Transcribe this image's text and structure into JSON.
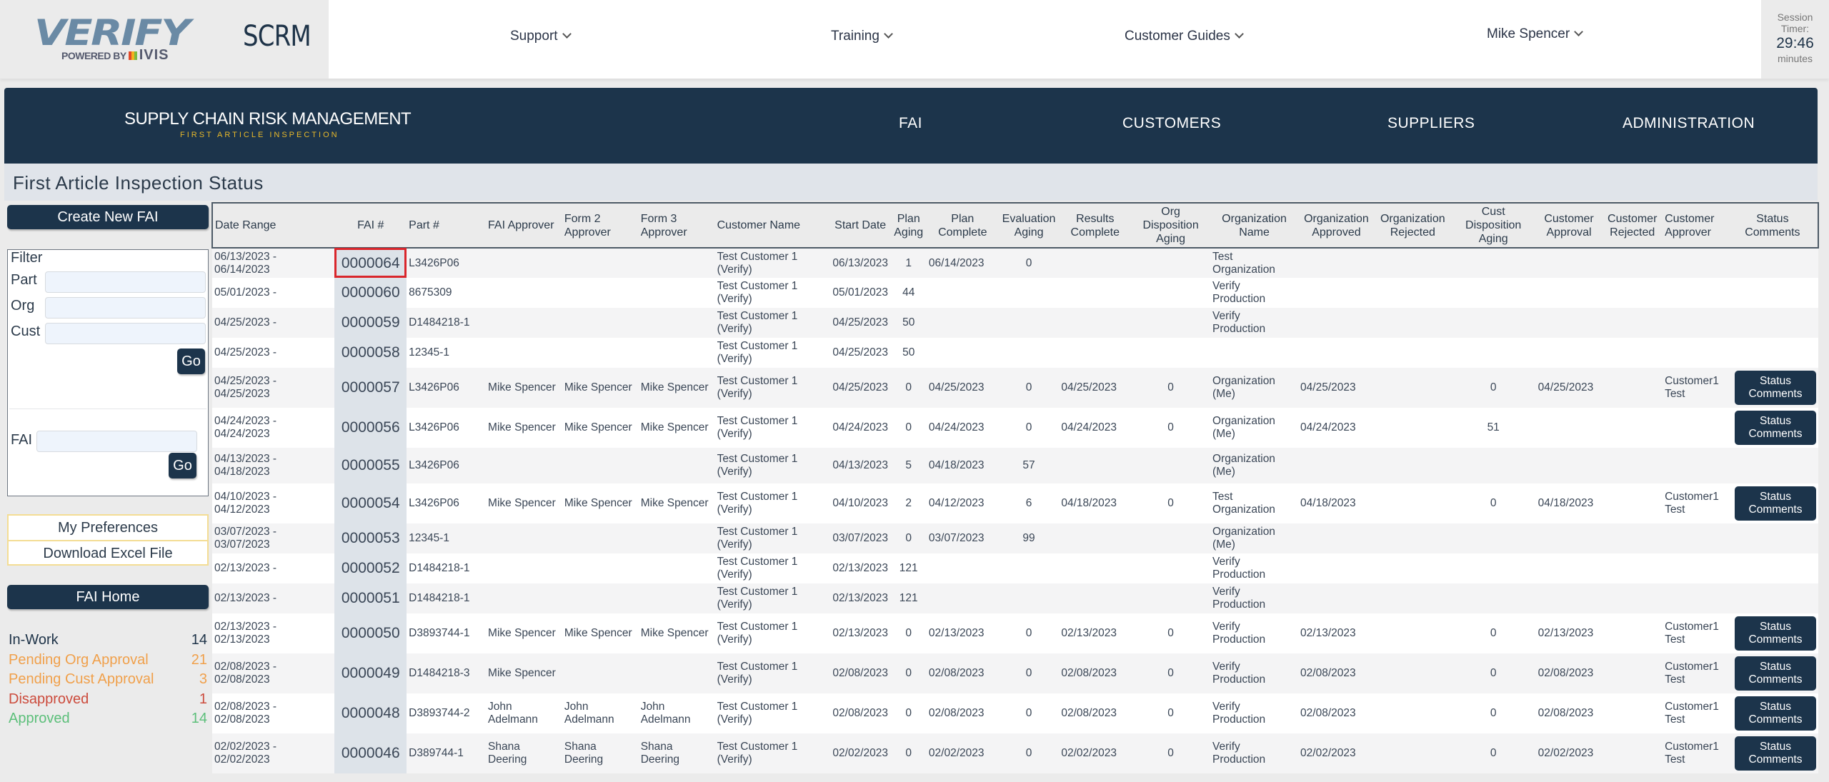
{
  "topbar": {
    "logo_text": "VERIFY",
    "logo_powered": "POWERED BY",
    "logo_brand": "IVIS",
    "app_name": "SCRM",
    "nav": [
      {
        "label": "Support"
      },
      {
        "label": "Training"
      },
      {
        "label": "Customer Guides"
      },
      {
        "label": "Mike Spencer"
      }
    ],
    "session": {
      "label1": "Session",
      "label2": "Timer:",
      "value": "29:46",
      "unit": "minutes"
    }
  },
  "banner": {
    "title": "SUPPLY CHAIN RISK MANAGEMENT",
    "subtitle": "FIRST ARTICLE INSPECTION",
    "nav": [
      "FAI",
      "CUSTOMERS",
      "SUPPLIERS",
      "ADMINISTRATION"
    ]
  },
  "page_title": "First Article Inspection Status",
  "sidebar": {
    "create_label": "Create New FAI",
    "filter_label": "Filter",
    "part_label": "Part",
    "part_value": "",
    "org_label": "Org",
    "org_value": "",
    "cust_label": "Cust",
    "cust_value": "",
    "go_label": "Go",
    "fai_label": "FAI",
    "fai_value": "",
    "fai_go_label": "Go",
    "preferences_label": "My Preferences",
    "download_label": "Download Excel File",
    "home_label": "FAI Home",
    "stats": [
      {
        "label": "In-Work",
        "count": "14",
        "color": "#1e3348"
      },
      {
        "label": "Pending Org Approval",
        "count": "21",
        "color": "#f0a04b"
      },
      {
        "label": "Pending Cust Approval",
        "count": "3",
        "color": "#f0a04b"
      },
      {
        "label": "Disapproved",
        "count": "1",
        "color": "#cc4b3c"
      },
      {
        "label": "Approved",
        "count": "14",
        "color": "#5cbf7a"
      }
    ]
  },
  "table": {
    "columns": [
      "Date Range",
      "FAI #",
      "Part #",
      "FAI Approver",
      "Form 2 Approver",
      "Form 3 Approver",
      "Customer Name",
      "Start Date",
      "Plan Aging",
      "Plan Complete",
      "Evaluation Aging",
      "Results Complete",
      "Org Disposition Aging",
      "Organization Name",
      "Organization Approved",
      "Organization Rejected",
      "Cust Disposition Aging",
      "Customer Approval",
      "Customer Rejected",
      "Customer Approver",
      "Status Comments"
    ],
    "status_button_label": "Status Comments",
    "selected_fai": "0000064",
    "rows": [
      {
        "date_range": "06/13/2023 - 06/14/2023",
        "fai": "0000064",
        "part": "L3426P06",
        "fai_approver": "",
        "form2": "",
        "form3": "",
        "customer": "Test Customer 1 (Verify)",
        "start": "06/13/2023",
        "plan_aging": "1",
        "plan_complete": "06/14/2023",
        "eval_aging": "0",
        "results_complete": "",
        "org_disp_aging": "",
        "org_name": "Test Organization",
        "org_approved": "",
        "org_rejected": "",
        "cust_disp_aging": "",
        "cust_approval": "",
        "cust_rejected": "",
        "cust_approver": "",
        "status_btn": false
      },
      {
        "date_range": "05/01/2023 -",
        "fai": "0000060",
        "part": "8675309",
        "fai_approver": "",
        "form2": "",
        "form3": "",
        "customer": "Test Customer 1 (Verify)",
        "start": "05/01/2023",
        "plan_aging": "44",
        "plan_complete": "",
        "eval_aging": "",
        "results_complete": "",
        "org_disp_aging": "",
        "org_name": "Verify Production",
        "org_approved": "",
        "org_rejected": "",
        "cust_disp_aging": "",
        "cust_approval": "",
        "cust_rejected": "",
        "cust_approver": "",
        "status_btn": false
      },
      {
        "date_range": "04/25/2023 -",
        "fai": "0000059",
        "part": "D1484218-1",
        "fai_approver": "",
        "form2": "",
        "form3": "",
        "customer": "Test Customer 1 (Verify)",
        "start": "04/25/2023",
        "plan_aging": "50",
        "plan_complete": "",
        "eval_aging": "",
        "results_complete": "",
        "org_disp_aging": "",
        "org_name": "Verify Production",
        "org_approved": "",
        "org_rejected": "",
        "cust_disp_aging": "",
        "cust_approval": "",
        "cust_rejected": "",
        "cust_approver": "",
        "status_btn": false
      },
      {
        "date_range": "04/25/2023 -",
        "fai": "0000058",
        "part": "12345-1",
        "fai_approver": "",
        "form2": "",
        "form3": "",
        "customer": "Test Customer 1 (Verify)",
        "start": "04/25/2023",
        "plan_aging": "50",
        "plan_complete": "",
        "eval_aging": "",
        "results_complete": "",
        "org_disp_aging": "",
        "org_name": "",
        "org_approved": "",
        "org_rejected": "",
        "cust_disp_aging": "",
        "cust_approval": "",
        "cust_rejected": "",
        "cust_approver": "",
        "status_btn": false
      },
      {
        "date_range": "04/25/2023 - 04/25/2023",
        "fai": "0000057",
        "part": "L3426P06",
        "fai_approver": "Mike Spencer",
        "form2": "Mike Spencer",
        "form3": "Mike Spencer",
        "customer": "Test Customer 1 (Verify)",
        "start": "04/25/2023",
        "plan_aging": "0",
        "plan_complete": "04/25/2023",
        "eval_aging": "0",
        "results_complete": "04/25/2023",
        "org_disp_aging": "0",
        "org_name": "Organization (Me)",
        "org_approved": "04/25/2023",
        "org_rejected": "",
        "cust_disp_aging": "0",
        "cust_approval": "04/25/2023",
        "cust_rejected": "",
        "cust_approver": "Customer1 Test",
        "status_btn": true
      },
      {
        "date_range": "04/24/2023 - 04/24/2023",
        "fai": "0000056",
        "part": "L3426P06",
        "fai_approver": "Mike Spencer",
        "form2": "Mike Spencer",
        "form3": "Mike Spencer",
        "customer": "Test Customer 1 (Verify)",
        "start": "04/24/2023",
        "plan_aging": "0",
        "plan_complete": "04/24/2023",
        "eval_aging": "0",
        "results_complete": "04/24/2023",
        "org_disp_aging": "0",
        "org_name": "Organization (Me)",
        "org_approved": "04/24/2023",
        "org_rejected": "",
        "cust_disp_aging": "51",
        "cust_approval": "",
        "cust_rejected": "",
        "cust_approver": "",
        "status_btn": true
      },
      {
        "date_range": "04/13/2023 - 04/18/2023",
        "fai": "0000055",
        "part": "L3426P06",
        "fai_approver": "",
        "form2": "",
        "form3": "",
        "customer": "Test Customer 1 (Verify)",
        "start": "04/13/2023",
        "plan_aging": "5",
        "plan_complete": "04/18/2023",
        "eval_aging": "57",
        "results_complete": "",
        "org_disp_aging": "",
        "org_name": "Organization (Me)",
        "org_approved": "",
        "org_rejected": "",
        "cust_disp_aging": "",
        "cust_approval": "",
        "cust_rejected": "",
        "cust_approver": "",
        "status_btn": false
      },
      {
        "date_range": "04/10/2023 - 04/12/2023",
        "fai": "0000054",
        "part": "L3426P06",
        "fai_approver": "Mike Spencer",
        "form2": "Mike Spencer",
        "form3": "Mike Spencer",
        "customer": "Test Customer 1 (Verify)",
        "start": "04/10/2023",
        "plan_aging": "2",
        "plan_complete": "04/12/2023",
        "eval_aging": "6",
        "results_complete": "04/18/2023",
        "org_disp_aging": "0",
        "org_name": "Test Organization",
        "org_approved": "04/18/2023",
        "org_rejected": "",
        "cust_disp_aging": "0",
        "cust_approval": "04/18/2023",
        "cust_rejected": "",
        "cust_approver": "Customer1 Test",
        "status_btn": true
      },
      {
        "date_range": "03/07/2023 - 03/07/2023",
        "fai": "0000053",
        "part": "12345-1",
        "fai_approver": "",
        "form2": "",
        "form3": "",
        "customer": "Test Customer 1 (Verify)",
        "start": "03/07/2023",
        "plan_aging": "0",
        "plan_complete": "03/07/2023",
        "eval_aging": "99",
        "results_complete": "",
        "org_disp_aging": "",
        "org_name": "Organization (Me)",
        "org_approved": "",
        "org_rejected": "",
        "cust_disp_aging": "",
        "cust_approval": "",
        "cust_rejected": "",
        "cust_approver": "",
        "status_btn": false
      },
      {
        "date_range": "02/13/2023 -",
        "fai": "0000052",
        "part": "D1484218-1",
        "fai_approver": "",
        "form2": "",
        "form3": "",
        "customer": "Test Customer 1 (Verify)",
        "start": "02/13/2023",
        "plan_aging": "121",
        "plan_complete": "",
        "eval_aging": "",
        "results_complete": "",
        "org_disp_aging": "",
        "org_name": "Verify Production",
        "org_approved": "",
        "org_rejected": "",
        "cust_disp_aging": "",
        "cust_approval": "",
        "cust_rejected": "",
        "cust_approver": "",
        "status_btn": false
      },
      {
        "date_range": "02/13/2023 -",
        "fai": "0000051",
        "part": "D1484218-1",
        "fai_approver": "",
        "form2": "",
        "form3": "",
        "customer": "Test Customer 1 (Verify)",
        "start": "02/13/2023",
        "plan_aging": "121",
        "plan_complete": "",
        "eval_aging": "",
        "results_complete": "",
        "org_disp_aging": "",
        "org_name": "Verify Production",
        "org_approved": "",
        "org_rejected": "",
        "cust_disp_aging": "",
        "cust_approval": "",
        "cust_rejected": "",
        "cust_approver": "",
        "status_btn": false
      },
      {
        "date_range": "02/13/2023 - 02/13/2023",
        "fai": "0000050",
        "part": "D3893744-1",
        "fai_approver": "Mike Spencer",
        "form2": "Mike Spencer",
        "form3": "Mike Spencer",
        "customer": "Test Customer 1 (Verify)",
        "start": "02/13/2023",
        "plan_aging": "0",
        "plan_complete": "02/13/2023",
        "eval_aging": "0",
        "results_complete": "02/13/2023",
        "org_disp_aging": "0",
        "org_name": "Verify Production",
        "org_approved": "02/13/2023",
        "org_rejected": "",
        "cust_disp_aging": "0",
        "cust_approval": "02/13/2023",
        "cust_rejected": "",
        "cust_approver": "Customer1 Test",
        "status_btn": true
      },
      {
        "date_range": "02/08/2023 - 02/08/2023",
        "fai": "0000049",
        "part": "D1484218-3",
        "fai_approver": "Mike Spencer",
        "form2": "",
        "form3": "",
        "customer": "Test Customer 1 (Verify)",
        "start": "02/08/2023",
        "plan_aging": "0",
        "plan_complete": "02/08/2023",
        "eval_aging": "0",
        "results_complete": "02/08/2023",
        "org_disp_aging": "0",
        "org_name": "Verify Production",
        "org_approved": "02/08/2023",
        "org_rejected": "",
        "cust_disp_aging": "0",
        "cust_approval": "02/08/2023",
        "cust_rejected": "",
        "cust_approver": "Customer1 Test",
        "status_btn": true
      },
      {
        "date_range": "02/08/2023 - 02/08/2023",
        "fai": "0000048",
        "part": "D3893744-2",
        "fai_approver": "John Adelmann",
        "form2": "John Adelmann",
        "form3": "John Adelmann",
        "customer": "Test Customer 1 (Verify)",
        "start": "02/08/2023",
        "plan_aging": "0",
        "plan_complete": "02/08/2023",
        "eval_aging": "0",
        "results_complete": "02/08/2023",
        "org_disp_aging": "0",
        "org_name": "Verify Production",
        "org_approved": "02/08/2023",
        "org_rejected": "",
        "cust_disp_aging": "0",
        "cust_approval": "02/08/2023",
        "cust_rejected": "",
        "cust_approver": "Customer1 Test",
        "status_btn": true
      },
      {
        "date_range": "02/02/2023 - 02/02/2023",
        "fai": "0000046",
        "part": "D389744-1",
        "fai_approver": "Shana Deering",
        "form2": "Shana Deering",
        "form3": "Shana Deering",
        "customer": "Test Customer 1 (Verify)",
        "start": "02/02/2023",
        "plan_aging": "0",
        "plan_complete": "02/02/2023",
        "eval_aging": "0",
        "results_complete": "02/02/2023",
        "org_disp_aging": "0",
        "org_name": "Verify Production",
        "org_approved": "02/02/2023",
        "org_rejected": "",
        "cust_disp_aging": "0",
        "cust_approval": "02/02/2023",
        "cust_rejected": "",
        "cust_approver": "Customer1 Test",
        "status_btn": true
      }
    ]
  }
}
